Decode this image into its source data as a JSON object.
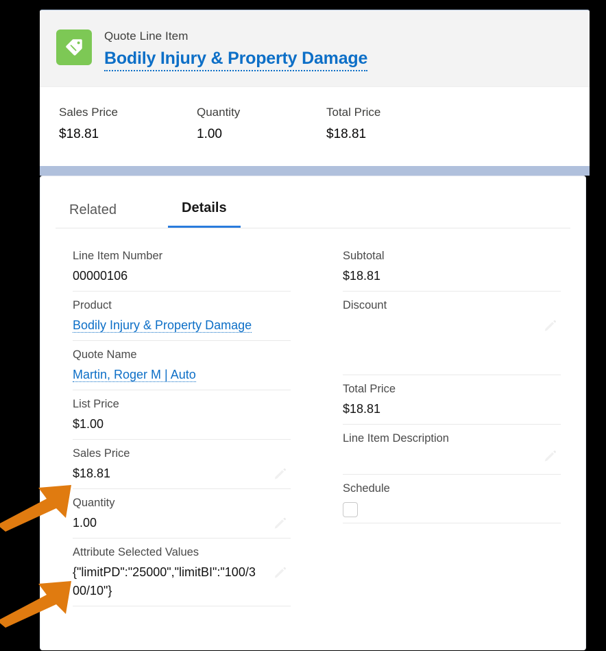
{
  "header": {
    "icon": "price-tag-icon",
    "icon_color": "#7dc855",
    "record_type": "Quote Line Item",
    "record_title": "Bodily Injury & Property Damage",
    "link_color": "#0d6fc7",
    "stats": [
      {
        "label": "Sales Price",
        "value": "$18.81"
      },
      {
        "label": "Quantity",
        "value": "1.00"
      },
      {
        "label": "Total Price",
        "value": "$18.81"
      }
    ]
  },
  "tabs": [
    {
      "label": "Related",
      "active": false
    },
    {
      "label": "Details",
      "active": true
    }
  ],
  "details": {
    "left_column": [
      {
        "label": "Line Item Number",
        "value": "00000106",
        "type": "text",
        "editable": false
      },
      {
        "label": "Product",
        "value": "Bodily Injury & Property Damage",
        "type": "link",
        "editable": false
      },
      {
        "label": "Quote Name",
        "value": "Martin, Roger M | Auto",
        "type": "link",
        "editable": false
      },
      {
        "label": "List Price",
        "value": "$1.00",
        "type": "text",
        "editable": false
      },
      {
        "label": "Sales Price",
        "value": "$18.81",
        "type": "text",
        "editable": true
      },
      {
        "label": "Quantity",
        "value": "1.00",
        "type": "text",
        "editable": true
      },
      {
        "label": "Attribute Selected Values",
        "value": "{\"limitPD\":\"25000\",\"limitBI\":\"100/300/10\"}",
        "type": "text",
        "editable": true
      }
    ],
    "right_column": [
      {
        "label": "Subtotal",
        "value": "$18.81",
        "type": "text",
        "editable": false
      },
      {
        "label": "Discount",
        "value": "",
        "type": "text",
        "editable": true
      },
      {
        "label": "Total Price",
        "value": "$18.81",
        "type": "text",
        "editable": false
      },
      {
        "label": "Line Item Description",
        "value": "",
        "type": "text",
        "editable": true
      },
      {
        "label": "Schedule",
        "value": "",
        "type": "checkbox",
        "checked": false,
        "editable": true
      }
    ]
  },
  "annotations": {
    "color": "#e07b10",
    "arrows": [
      {
        "name": "sales-price-arrow",
        "points_to": "Sales Price"
      },
      {
        "name": "attribute-selected-values-arrow",
        "points_to": "Attribute Selected Values"
      }
    ]
  }
}
